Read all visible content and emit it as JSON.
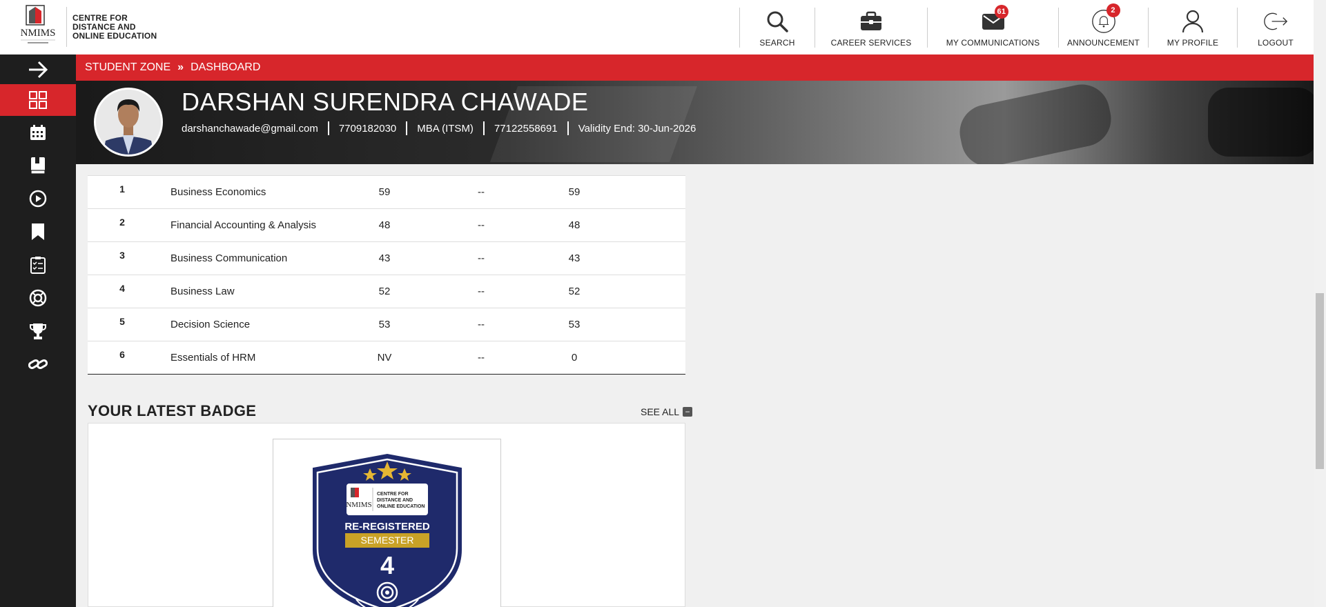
{
  "brand": {
    "lines": [
      "CENTRE FOR",
      "DISTANCE AND",
      "ONLINE EDUCATION"
    ],
    "logo_text": "NMIMS"
  },
  "nav": {
    "search": "SEARCH",
    "career": "CAREER SERVICES",
    "communications": "MY COMMUNICATIONS",
    "communications_count": "61",
    "announcement": "ANNOUNCEMENT",
    "announcement_count": "2",
    "profile": "MY PROFILE",
    "logout": "LOGOUT"
  },
  "breadcrumb": {
    "root": "STUDENT ZONE",
    "separator": "»",
    "current": "DASHBOARD"
  },
  "profile": {
    "name": "DARSHAN SURENDRA CHAWADE",
    "email": "darshanchawade@gmail.com",
    "phone": "7709182030",
    "program": "MBA (ITSM)",
    "student_no": "77122558691",
    "validity": "Validity End: 30-Jun-2026"
  },
  "marks": {
    "rows": [
      {
        "no": "1",
        "subject": "Business Economics",
        "a": "59",
        "b": "--",
        "c": "59"
      },
      {
        "no": "2",
        "subject": "Financial Accounting & Analysis",
        "a": "48",
        "b": "--",
        "c": "48"
      },
      {
        "no": "3",
        "subject": "Business Communication",
        "a": "43",
        "b": "--",
        "c": "43"
      },
      {
        "no": "4",
        "subject": "Business Law",
        "a": "52",
        "b": "--",
        "c": "52"
      },
      {
        "no": "5",
        "subject": "Decision Science",
        "a": "53",
        "b": "--",
        "c": "53"
      },
      {
        "no": "6",
        "subject": "Essentials of HRM",
        "a": "NV",
        "b": "--",
        "c": "0"
      }
    ]
  },
  "badge_section": {
    "title": "YOUR LATEST BADGE",
    "see_all": "SEE ALL",
    "badge": {
      "logo_text": "NMIMS",
      "org_lines": [
        "CENTRE FOR",
        "DISTANCE AND",
        "ONLINE EDUCATION"
      ],
      "title": "RE-REGISTERED",
      "ribbon": "SEMESTER",
      "number": "4"
    }
  },
  "colors": {
    "brand_red": "#d7262b",
    "sidebar_bg": "#1e1e1e",
    "badge_navy": "#1f2a6b",
    "badge_gold": "#c9a227"
  }
}
